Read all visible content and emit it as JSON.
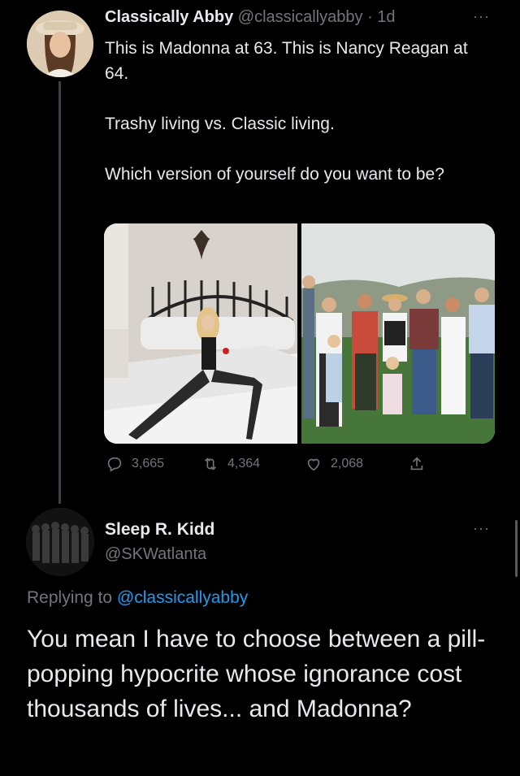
{
  "tweet": {
    "author": {
      "name": "Classically Abby",
      "handle": "@classicallyabby",
      "separator": "·",
      "time": "1d",
      "more": "···"
    },
    "paragraphs": [
      "This is Madonna at 63. This is Nancy Reagan at 64.",
      "Trashy living vs. Classic living.",
      "Which version of yourself do you want to be?"
    ],
    "stats": {
      "replies": "3,665",
      "retweets": "4,364",
      "likes": "2,068"
    }
  },
  "reply": {
    "author": {
      "name": "Sleep R. Kidd",
      "handle": "@SKWatlanta",
      "more": "···"
    },
    "replying_prefix": "Replying to",
    "replying_to": "@classicallyabby",
    "text": "You mean I have to choose between a pill-popping hypocrite whose ignorance cost thousands of lives... and Madonna?"
  },
  "icons": [
    "reply-icon",
    "retweet-icon",
    "like-icon",
    "share-icon",
    "more-icon"
  ],
  "colors": {
    "background": "#000000",
    "text": "#e7e9ea",
    "muted": "#71767b",
    "accent": "#1d9bf0"
  }
}
